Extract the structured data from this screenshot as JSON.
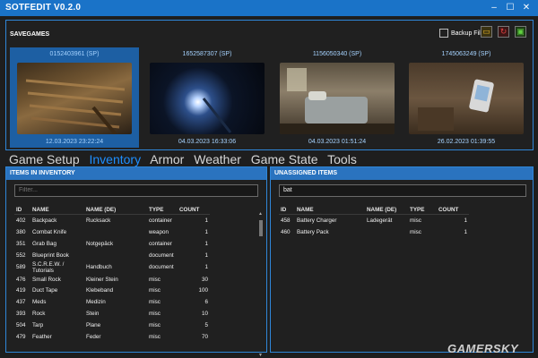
{
  "titlebar": {
    "title": "SOTFEDIT V0.2.0",
    "icons": [
      "minimize-icon",
      "maximize-icon",
      "close-icon"
    ]
  },
  "savegames": {
    "header": "SAVEGAMES",
    "backup_label": "Backup Files",
    "backup_checked": false,
    "tools": [
      "folder-icon",
      "refresh-icon",
      "save-icon"
    ],
    "slots": [
      {
        "id": "0152403961 (SP)",
        "date": "12.03.2023 23:22:24",
        "selected": true
      },
      {
        "id": "1652587307 (SP)",
        "date": "04.03.2023 16:33:06",
        "selected": false
      },
      {
        "id": "1156050340 (SP)",
        "date": "04.03.2023 01:51:24",
        "selected": false
      },
      {
        "id": "1745063249 (SP)",
        "date": "26.02.2023 01:39:55",
        "selected": false
      }
    ]
  },
  "tabs": [
    {
      "label": "Game Setup",
      "active": false
    },
    {
      "label": "Inventory",
      "active": true
    },
    {
      "label": "Armor",
      "active": false
    },
    {
      "label": "Weather",
      "active": false
    },
    {
      "label": "Game State",
      "active": false
    },
    {
      "label": "Tools",
      "active": false
    }
  ],
  "inventory": {
    "header": "ITEMS IN INVENTORY",
    "filter_placeholder": "Filter...",
    "columns": [
      "ID",
      "NAME",
      "NAME (DE)",
      "TYPE",
      "COUNT"
    ],
    "rows": [
      [
        "402",
        "Backpack",
        "Rucksack",
        "container",
        "1"
      ],
      [
        "380",
        "Combat Knife",
        "",
        "weapon",
        "1"
      ],
      [
        "351",
        "Grab Bag",
        "Notgepäck",
        "container",
        "1"
      ],
      [
        "552",
        "Blueprint Book",
        "",
        "document",
        "1"
      ],
      [
        "589",
        "S.C.R.E.W. / Tutorials",
        "Handbuch",
        "document",
        "1"
      ],
      [
        "476",
        "Small Rock",
        "Kleiner Stein",
        "misc",
        "30"
      ],
      [
        "419",
        "Duct Tape",
        "Klebeband",
        "misc",
        "100"
      ],
      [
        "437",
        "Meds",
        "Medizin",
        "misc",
        "6"
      ],
      [
        "393",
        "Rock",
        "Stein",
        "misc",
        "10"
      ],
      [
        "504",
        "Tarp",
        "Plane",
        "misc",
        "5"
      ],
      [
        "479",
        "Feather",
        "Feder",
        "misc",
        "70"
      ]
    ]
  },
  "unassigned": {
    "header": "UNASSIGNED ITEMS",
    "filter_value": "bat",
    "columns": [
      "ID",
      "NAME",
      "NAME (DE)",
      "TYPE",
      "COUNT"
    ],
    "rows": [
      [
        "458",
        "Battery Charger",
        "Ladegerät",
        "misc",
        "1"
      ],
      [
        "460",
        "Battery Pack",
        "",
        "misc",
        "1"
      ]
    ]
  },
  "watermark": "GAMERSKY"
}
